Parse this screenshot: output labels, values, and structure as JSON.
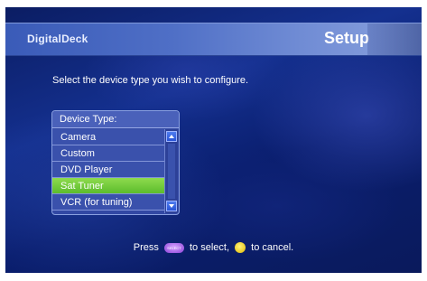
{
  "header": {
    "brand": "DigitalDeck",
    "title": "Setup"
  },
  "prompt": "Select the device type you wish to configure.",
  "device_list": {
    "header": "Device Type:",
    "items": [
      {
        "label": "Camera"
      },
      {
        "label": "Custom"
      },
      {
        "label": "DVD Player"
      },
      {
        "label": "Sat Tuner"
      },
      {
        "label": "VCR (for tuning)"
      }
    ],
    "selected": "Sat Tuner"
  },
  "footer": {
    "press": "Press",
    "to_select": "to select,",
    "to_cancel": "to cancel.",
    "select_button_icon": "select-button-icon",
    "cancel_button_icon": "cancel-button-icon"
  },
  "colors": {
    "selection": "#6ccb38",
    "header_bar": "#4f6fc6",
    "background": "#14308f",
    "select_button": "#a45cf0",
    "cancel_button": "#f0cc10"
  }
}
